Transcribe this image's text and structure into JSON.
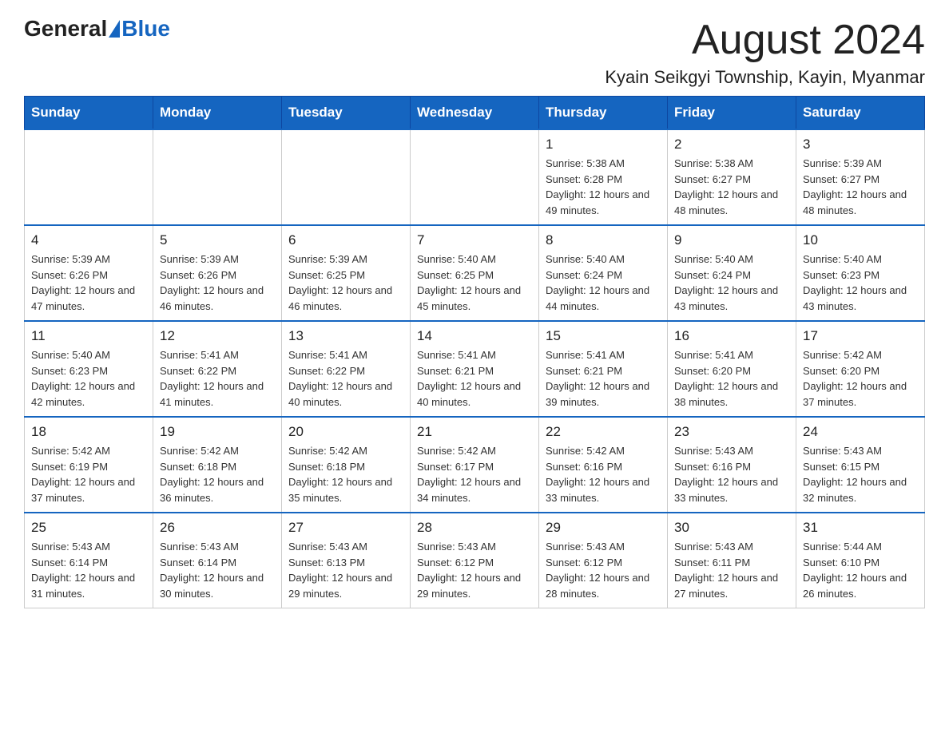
{
  "header": {
    "logo_general": "General",
    "logo_blue": "Blue",
    "main_title": "August 2024",
    "subtitle": "Kyain Seikgyi Township, Kayin, Myanmar"
  },
  "calendar": {
    "days_of_week": [
      "Sunday",
      "Monday",
      "Tuesday",
      "Wednesday",
      "Thursday",
      "Friday",
      "Saturday"
    ],
    "weeks": [
      [
        {
          "day": "",
          "info": ""
        },
        {
          "day": "",
          "info": ""
        },
        {
          "day": "",
          "info": ""
        },
        {
          "day": "",
          "info": ""
        },
        {
          "day": "1",
          "info": "Sunrise: 5:38 AM\nSunset: 6:28 PM\nDaylight: 12 hours and 49 minutes."
        },
        {
          "day": "2",
          "info": "Sunrise: 5:38 AM\nSunset: 6:27 PM\nDaylight: 12 hours and 48 minutes."
        },
        {
          "day": "3",
          "info": "Sunrise: 5:39 AM\nSunset: 6:27 PM\nDaylight: 12 hours and 48 minutes."
        }
      ],
      [
        {
          "day": "4",
          "info": "Sunrise: 5:39 AM\nSunset: 6:26 PM\nDaylight: 12 hours and 47 minutes."
        },
        {
          "day": "5",
          "info": "Sunrise: 5:39 AM\nSunset: 6:26 PM\nDaylight: 12 hours and 46 minutes."
        },
        {
          "day": "6",
          "info": "Sunrise: 5:39 AM\nSunset: 6:25 PM\nDaylight: 12 hours and 46 minutes."
        },
        {
          "day": "7",
          "info": "Sunrise: 5:40 AM\nSunset: 6:25 PM\nDaylight: 12 hours and 45 minutes."
        },
        {
          "day": "8",
          "info": "Sunrise: 5:40 AM\nSunset: 6:24 PM\nDaylight: 12 hours and 44 minutes."
        },
        {
          "day": "9",
          "info": "Sunrise: 5:40 AM\nSunset: 6:24 PM\nDaylight: 12 hours and 43 minutes."
        },
        {
          "day": "10",
          "info": "Sunrise: 5:40 AM\nSunset: 6:23 PM\nDaylight: 12 hours and 43 minutes."
        }
      ],
      [
        {
          "day": "11",
          "info": "Sunrise: 5:40 AM\nSunset: 6:23 PM\nDaylight: 12 hours and 42 minutes."
        },
        {
          "day": "12",
          "info": "Sunrise: 5:41 AM\nSunset: 6:22 PM\nDaylight: 12 hours and 41 minutes."
        },
        {
          "day": "13",
          "info": "Sunrise: 5:41 AM\nSunset: 6:22 PM\nDaylight: 12 hours and 40 minutes."
        },
        {
          "day": "14",
          "info": "Sunrise: 5:41 AM\nSunset: 6:21 PM\nDaylight: 12 hours and 40 minutes."
        },
        {
          "day": "15",
          "info": "Sunrise: 5:41 AM\nSunset: 6:21 PM\nDaylight: 12 hours and 39 minutes."
        },
        {
          "day": "16",
          "info": "Sunrise: 5:41 AM\nSunset: 6:20 PM\nDaylight: 12 hours and 38 minutes."
        },
        {
          "day": "17",
          "info": "Sunrise: 5:42 AM\nSunset: 6:20 PM\nDaylight: 12 hours and 37 minutes."
        }
      ],
      [
        {
          "day": "18",
          "info": "Sunrise: 5:42 AM\nSunset: 6:19 PM\nDaylight: 12 hours and 37 minutes."
        },
        {
          "day": "19",
          "info": "Sunrise: 5:42 AM\nSunset: 6:18 PM\nDaylight: 12 hours and 36 minutes."
        },
        {
          "day": "20",
          "info": "Sunrise: 5:42 AM\nSunset: 6:18 PM\nDaylight: 12 hours and 35 minutes."
        },
        {
          "day": "21",
          "info": "Sunrise: 5:42 AM\nSunset: 6:17 PM\nDaylight: 12 hours and 34 minutes."
        },
        {
          "day": "22",
          "info": "Sunrise: 5:42 AM\nSunset: 6:16 PM\nDaylight: 12 hours and 33 minutes."
        },
        {
          "day": "23",
          "info": "Sunrise: 5:43 AM\nSunset: 6:16 PM\nDaylight: 12 hours and 33 minutes."
        },
        {
          "day": "24",
          "info": "Sunrise: 5:43 AM\nSunset: 6:15 PM\nDaylight: 12 hours and 32 minutes."
        }
      ],
      [
        {
          "day": "25",
          "info": "Sunrise: 5:43 AM\nSunset: 6:14 PM\nDaylight: 12 hours and 31 minutes."
        },
        {
          "day": "26",
          "info": "Sunrise: 5:43 AM\nSunset: 6:14 PM\nDaylight: 12 hours and 30 minutes."
        },
        {
          "day": "27",
          "info": "Sunrise: 5:43 AM\nSunset: 6:13 PM\nDaylight: 12 hours and 29 minutes."
        },
        {
          "day": "28",
          "info": "Sunrise: 5:43 AM\nSunset: 6:12 PM\nDaylight: 12 hours and 29 minutes."
        },
        {
          "day": "29",
          "info": "Sunrise: 5:43 AM\nSunset: 6:12 PM\nDaylight: 12 hours and 28 minutes."
        },
        {
          "day": "30",
          "info": "Sunrise: 5:43 AM\nSunset: 6:11 PM\nDaylight: 12 hours and 27 minutes."
        },
        {
          "day": "31",
          "info": "Sunrise: 5:44 AM\nSunset: 6:10 PM\nDaylight: 12 hours and 26 minutes."
        }
      ]
    ]
  }
}
